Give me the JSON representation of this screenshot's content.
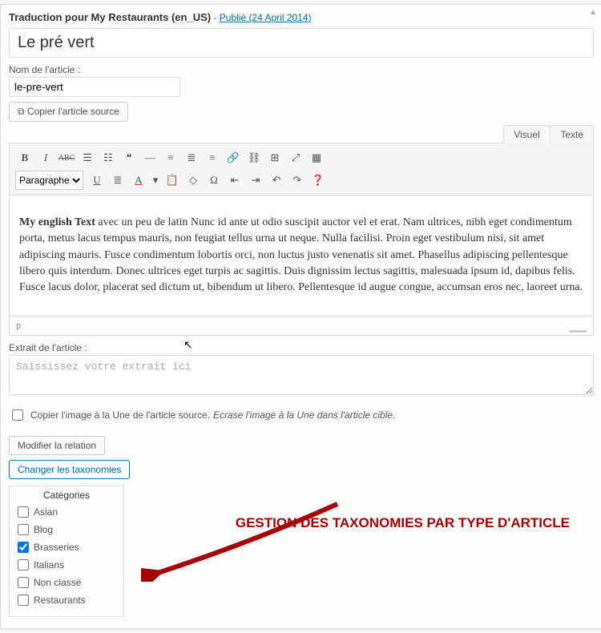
{
  "header": {
    "caption": "Traduction pour My Restaurants (en_US)",
    "sep": " - ",
    "link": "Publié (24 April 2014)"
  },
  "title": {
    "value": "Le pré vert"
  },
  "slug": {
    "label": "Nom de l'article :",
    "value": "le-pre-vert"
  },
  "buttons": {
    "copy_source": "Copier l'article source",
    "modify_relation": "Modifier la relation",
    "change_tax": "Changer les taxonomies"
  },
  "tabs": {
    "visual": "Visuel",
    "text": "Texte"
  },
  "format_select": "Paragraphe",
  "body": {
    "lead": "My english Text",
    "rest": " avec un peu de latin Nunc id ante ut odio suscipit auctor vel et erat. Nam ultrices, nibh eget condimentum porta, metus lacus tempus mauris, non feugiat tellus urna ut neque. Nulla facilisi. Proin eget vestibulum nisi, sit amet adipiscing mauris. Fusce condimentum lobortis orci, non luctus justo venenatis sit amet. Phasellus adipiscing pellentesque libero quis interdum. Donec ultrices eget turpis ac sagittis. Duis dignissim lectus sagittis, malesuada ipsum id, dapibus felis. Fusce lacus dolor, placerat sed dictum ut, bibendum ut libero. Pellentesque id augue congue, accumsan eros nec, laoreet urna."
  },
  "path": "p",
  "excerpt": {
    "label": "Extrait de l'article :",
    "placeholder": "Saississez votre extrait ici"
  },
  "featured_chk": {
    "label": "Copier l'image à la Une de l'article source.",
    "hint": "Ecrase l'image à la Une dans l'article cible."
  },
  "categories": {
    "title": "Catégories",
    "items": [
      {
        "label": "Asian",
        "checked": false
      },
      {
        "label": "Blog",
        "checked": false
      },
      {
        "label": "Brasseries",
        "checked": true
      },
      {
        "label": "Italians",
        "checked": false
      },
      {
        "label": "Non classé",
        "checked": false
      },
      {
        "label": "Restaurants",
        "checked": false
      }
    ]
  },
  "annotation": "GESTION DES TAXONOMIES PAR TYPE D'ARTICLE"
}
